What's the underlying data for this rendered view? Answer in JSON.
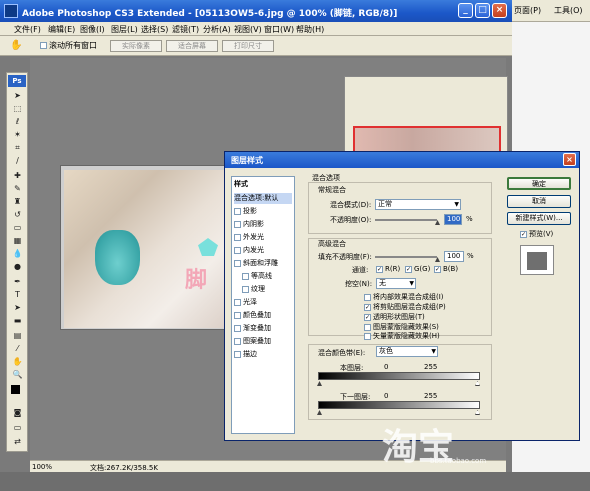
{
  "browser": {
    "menu_page": "页面(P)",
    "menu_tools": "工具(O)"
  },
  "app": {
    "title": "Adobe Photoshop CS3 Extended - [05113OW5-6.jpg @ 100% (脚链, RGB/8)]",
    "ps_logo": "Ps"
  },
  "menus": [
    "文件(F)",
    "编辑(E)",
    "图像(I)",
    "图层(L)",
    "选择(S)",
    "滤镜(T)",
    "分析(A)",
    "视图(V)",
    "窗口(W)",
    "帮助(H)"
  ],
  "options_bar": {
    "scroll_all_label": "滚动所有窗口",
    "buttons": [
      "实际像素",
      "适合屏幕",
      "打印尺寸"
    ]
  },
  "canvas": {
    "watermark_char": "脚"
  },
  "statusbar": {
    "zoom": "100%",
    "doc": "文档:267.2K/358.5K"
  },
  "dialog": {
    "title": "图层样式",
    "style_header": "样式",
    "styles": [
      {
        "label": "混合选项:默认",
        "checkbox": false,
        "selected": true
      },
      {
        "label": "投影",
        "checkbox": true,
        "checked": false
      },
      {
        "label": "内阴影",
        "checkbox": true,
        "checked": false
      },
      {
        "label": "外发光",
        "checkbox": true,
        "checked": false
      },
      {
        "label": "内发光",
        "checkbox": true,
        "checked": false
      },
      {
        "label": "斜面和浮雕",
        "checkbox": true,
        "checked": false
      },
      {
        "label": "等高线",
        "checkbox": true,
        "checked": false,
        "indent": true
      },
      {
        "label": "纹理",
        "checkbox": true,
        "checked": false,
        "indent": true
      },
      {
        "label": "光泽",
        "checkbox": true,
        "checked": false
      },
      {
        "label": "颜色叠加",
        "checkbox": true,
        "checked": false
      },
      {
        "label": "渐变叠加",
        "checkbox": true,
        "checked": false
      },
      {
        "label": "图案叠加",
        "checkbox": true,
        "checked": false
      },
      {
        "label": "描边",
        "checkbox": true,
        "checked": false
      }
    ],
    "blend_options_title": "混合选项",
    "general_title": "常规混合",
    "blend_mode_label": "混合模式(D):",
    "blend_mode_value": "正常",
    "opacity_label": "不透明度(O):",
    "opacity_value": "100",
    "percent": "%",
    "advanced_title": "高级混合",
    "fill_opacity_label": "填充不透明度(F):",
    "fill_opacity_value": "100",
    "channels_label": "通道:",
    "channels": [
      "R(R)",
      "G(G)",
      "B(B)"
    ],
    "knockout_label": "挖空(N):",
    "knockout_value": "无",
    "adv_options": [
      {
        "label": "将内部效果混合成组(I)",
        "checked": false
      },
      {
        "label": "将剪贴图层混合成组(P)",
        "checked": true
      },
      {
        "label": "透明形状图层(T)",
        "checked": true
      },
      {
        "label": "图层蒙版隐藏效果(S)",
        "checked": false
      },
      {
        "label": "矢量蒙版隐藏效果(H)",
        "checked": false
      }
    ],
    "blend_if_label": "混合颜色带(E):",
    "blend_if_value": "灰色",
    "this_layer_label": "本图层:",
    "under_layer_label": "下一图层:",
    "range_min": "0",
    "range_max": "255",
    "buttons": {
      "ok": "确定",
      "cancel": "取消",
      "new_style": "新建样式(W)...",
      "preview": "预览(V)"
    }
  },
  "watermark": {
    "main": "淘宝",
    "sub": "bbs.taobao.com"
  }
}
